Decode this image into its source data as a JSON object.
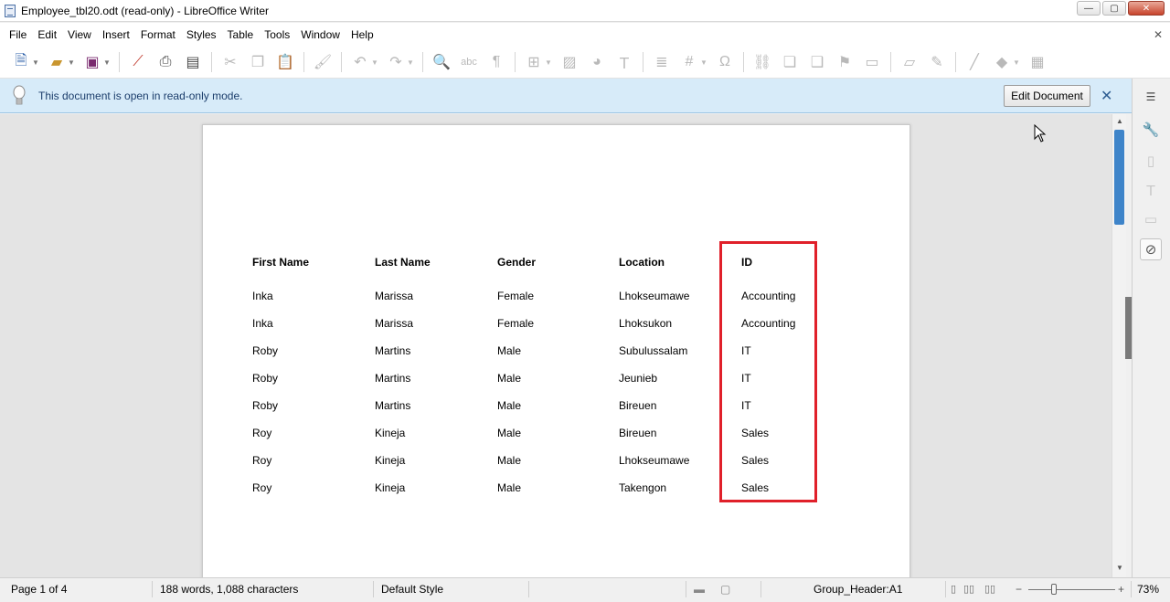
{
  "window": {
    "title": "Employee_tbl20.odt (read-only) - LibreOffice Writer",
    "minimize": "—",
    "maximize": "▢",
    "close": "✕"
  },
  "menu": {
    "items": [
      "File",
      "Edit",
      "View",
      "Insert",
      "Format",
      "Styles",
      "Table",
      "Tools",
      "Window",
      "Help"
    ],
    "close_doc": "✕"
  },
  "toolbar": {
    "icons": [
      "new-icon",
      "open-icon",
      "save-icon",
      "export-pdf-icon",
      "print-icon",
      "print-preview-icon",
      "cut-icon",
      "copy-icon",
      "paste-icon",
      "clone-format-icon",
      "undo-icon",
      "redo-icon",
      "find-replace-icon",
      "spellcheck-icon",
      "formatting-marks-icon",
      "insert-table-icon",
      "insert-image-icon",
      "insert-chart-icon",
      "insert-textbox-icon",
      "page-break-icon",
      "insert-field-icon",
      "special-character-icon",
      "hyperlink-icon",
      "footnote-icon",
      "endnote-icon",
      "bookmark-icon",
      "cross-reference-icon",
      "comment-icon",
      "track-changes-icon",
      "line-icon",
      "basic-shapes-icon",
      "draw-functions-icon"
    ]
  },
  "infobar": {
    "message": "This document is open in read-only mode.",
    "edit_button": "Edit Document",
    "close": "✕"
  },
  "table": {
    "headers": [
      "First Name",
      "Last Name",
      "Gender",
      "Location",
      "ID"
    ],
    "rows": [
      [
        "Inka",
        "Marissa",
        "Female",
        "Lhokseumawe",
        "Accounting"
      ],
      [
        "Inka",
        "Marissa",
        "Female",
        "Lhoksukon",
        "Accounting"
      ],
      [
        "Roby",
        "Martins",
        "Male",
        "Subulussalam",
        "IT"
      ],
      [
        "Roby",
        "Martins",
        "Male",
        "Jeunieb",
        "IT"
      ],
      [
        "Roby",
        "Martins",
        "Male",
        "Bireuen",
        "IT"
      ],
      [
        "Roy",
        "Kineja",
        "Male",
        "Bireuen",
        "Sales"
      ],
      [
        "Roy",
        "Kineja",
        "Male",
        "Lhokseumawe",
        "Sales"
      ],
      [
        "Roy",
        "Kineja",
        "Male",
        "Takengon",
        "Sales"
      ]
    ]
  },
  "highlight": {
    "color": "#e0202a"
  },
  "status": {
    "page": "Page 1 of 4",
    "words": "188 words, 1,088 characters",
    "page_style": "Default Style",
    "section": "Group_Header:A1",
    "zoom": "73%"
  }
}
